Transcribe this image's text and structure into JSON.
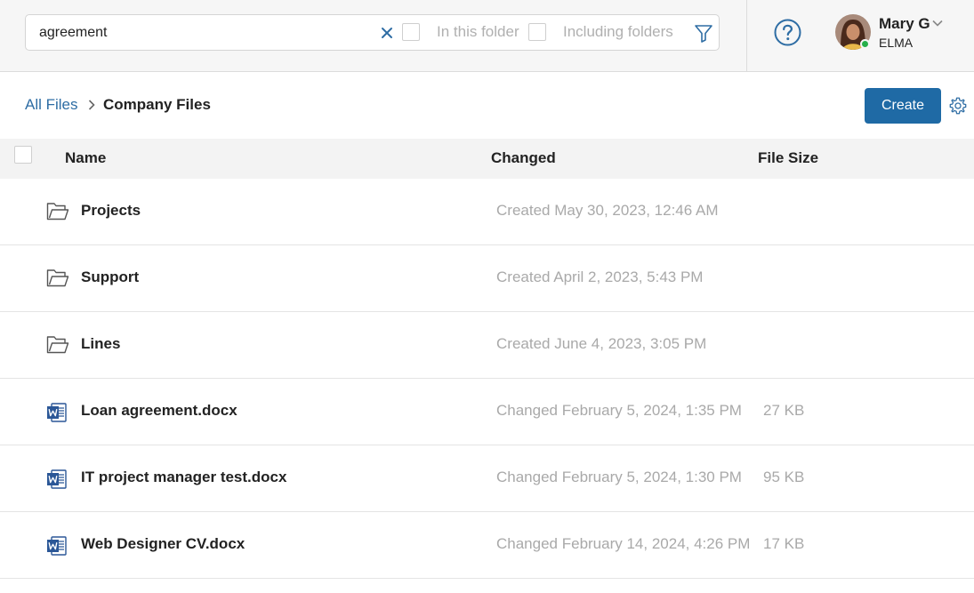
{
  "search": {
    "value": "agreement",
    "in_this_folder_label": "In this folder",
    "including_folders_label": "Including folders"
  },
  "user": {
    "name": "Mary G",
    "company": "ELMA",
    "status_color": "#27b04a"
  },
  "breadcrumb": {
    "root": "All Files",
    "current": "Company Files"
  },
  "toolbar": {
    "create_label": "Create"
  },
  "table": {
    "columns": {
      "name": "Name",
      "changed": "Changed",
      "size": "File Size"
    },
    "rows": [
      {
        "type": "folder",
        "icon": "folder-icon",
        "name": "Projects",
        "changed": "Created May 30, 2023, 12:46 AM",
        "size": ""
      },
      {
        "type": "folder",
        "icon": "folder-icon",
        "name": "Support",
        "changed": "Created April 2, 2023, 5:43 PM",
        "size": ""
      },
      {
        "type": "folder",
        "icon": "folder-icon",
        "name": "Lines",
        "changed": "Created June 4, 2023, 3:05 PM",
        "size": ""
      },
      {
        "type": "docx",
        "icon": "word-doc-icon",
        "name": "Loan agreement.docx",
        "changed": "Changed February 5, 2024, 1:35 PM",
        "size": "27 KB"
      },
      {
        "type": "docx",
        "icon": "word-doc-icon",
        "name": "IT project manager test.docx",
        "changed": "Changed February 5, 2024, 1:30 PM",
        "size": "95 KB"
      },
      {
        "type": "docx",
        "icon": "word-doc-icon",
        "name": "Web Designer CV.docx",
        "changed": "Changed February 14, 2024, 4:26 PM",
        "size": "17 KB"
      }
    ]
  },
  "colors": {
    "accent": "#1f6aa5",
    "link": "#2e6da4",
    "muted_text": "#a9a9a9",
    "word_blue": "#2b5797"
  }
}
